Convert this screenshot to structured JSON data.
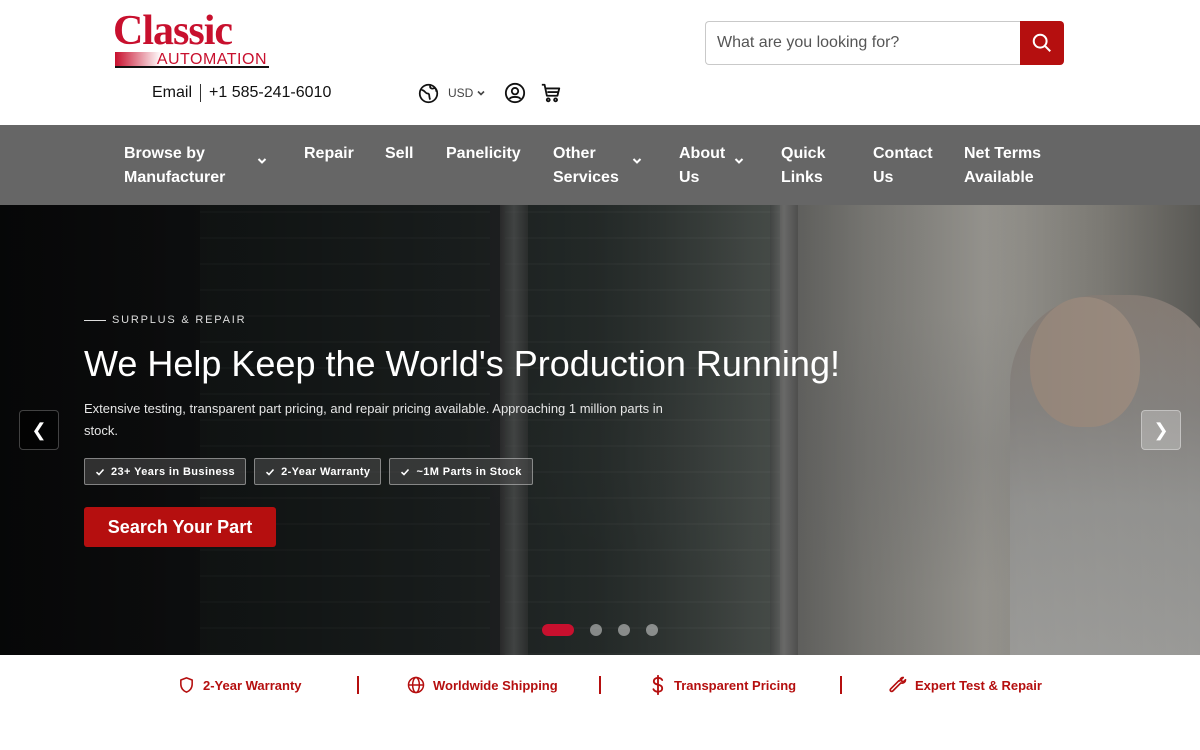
{
  "brand": {
    "logo_top": "Classic",
    "logo_bottom": "AUTOMATION",
    "accent_color": "#b50f0f"
  },
  "contact": {
    "email_label": "Email",
    "phone": "+1 585-241-6010"
  },
  "tools": {
    "currency": "USD",
    "icons": [
      "globe-icon",
      "account-icon",
      "cart-icon"
    ]
  },
  "search": {
    "placeholder": "What are you looking for?",
    "value": ""
  },
  "nav": {
    "items": [
      {
        "label_line1": "Browse by",
        "label_line2": "Manufacturer",
        "has_dropdown": true
      },
      {
        "label_line1": "Repair",
        "label_line2": "",
        "has_dropdown": false
      },
      {
        "label_line1": "Sell",
        "label_line2": "",
        "has_dropdown": false
      },
      {
        "label_line1": "Panelicity",
        "label_line2": "",
        "has_dropdown": false
      },
      {
        "label_line1": "Other",
        "label_line2": "Services",
        "has_dropdown": true
      },
      {
        "label_line1": "About",
        "label_line2": "Us",
        "has_dropdown": true
      },
      {
        "label_line1": "Quick",
        "label_line2": "Links",
        "has_dropdown": false
      },
      {
        "label_line1": "Contact",
        "label_line2": "Us",
        "has_dropdown": false
      },
      {
        "label_line1": "Net Terms",
        "label_line2": "Available",
        "has_dropdown": false
      }
    ]
  },
  "hero": {
    "eyebrow": "SURPLUS & REPAIR",
    "headline": "We Help Keep the World's Production Running!",
    "subtext": "Extensive testing, transparent part pricing, and repair pricing available. Approaching 1 million parts in stock.",
    "badges": [
      "23+ Years in Business",
      "2-Year Warranty",
      "~1M Parts in Stock"
    ],
    "cta_label": "Search Your Part",
    "prev_label": "❮",
    "next_label": "❯",
    "slide_count": 4,
    "active_slide": 1
  },
  "features": [
    {
      "label": "2-Year Warranty",
      "icon": "shield-icon"
    },
    {
      "label": "Worldwide Shipping",
      "icon": "globe-icon"
    },
    {
      "label": "Transparent Pricing",
      "icon": "dollar-icon"
    },
    {
      "label": "Expert Test & Repair",
      "icon": "wrench-icon"
    }
  ]
}
